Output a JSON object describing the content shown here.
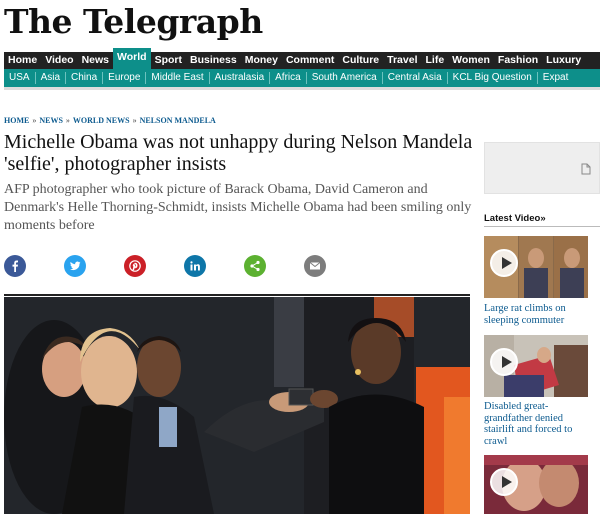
{
  "site": {
    "logo": "The Telegraph"
  },
  "nav_primary": [
    {
      "label": "Home"
    },
    {
      "label": "Video"
    },
    {
      "label": "News"
    },
    {
      "label": "World",
      "active": true
    },
    {
      "label": "Sport"
    },
    {
      "label": "Business"
    },
    {
      "label": "Money"
    },
    {
      "label": "Comment"
    },
    {
      "label": "Culture"
    },
    {
      "label": "Travel"
    },
    {
      "label": "Life"
    },
    {
      "label": "Women"
    },
    {
      "label": "Fashion"
    },
    {
      "label": "Luxury"
    }
  ],
  "nav_secondary": [
    {
      "label": "USA"
    },
    {
      "label": "Asia"
    },
    {
      "label": "China"
    },
    {
      "label": "Europe"
    },
    {
      "label": "Middle East"
    },
    {
      "label": "Australasia"
    },
    {
      "label": "Africa"
    },
    {
      "label": "South America"
    },
    {
      "label": "Central Asia"
    },
    {
      "label": "KCL Big Question"
    },
    {
      "label": "Expat"
    }
  ],
  "breadcrumb": [
    {
      "label": "HOME"
    },
    {
      "label": "NEWS"
    },
    {
      "label": "WORLD NEWS"
    },
    {
      "label": "NELSON MANDELA"
    }
  ],
  "article": {
    "headline": "Michelle Obama was not unhappy during Nelson Mandela 'selfie', photographer insists",
    "standfirst": "AFP photographer who took picture of Barack Obama, David Cameron and Denmark's Helle Thorning-Schmidt, insists Michelle Obama had been smiling only moments before"
  },
  "share_buttons": [
    {
      "name": "facebook-share-icon",
      "color": "#3b5998"
    },
    {
      "name": "twitter-share-icon",
      "color": "#2aa3ef"
    },
    {
      "name": "pinterest-share-icon",
      "color": "#cb2027"
    },
    {
      "name": "linkedin-share-icon",
      "color": "#0e76a8"
    },
    {
      "name": "share-icon",
      "color": "#5cb131"
    },
    {
      "name": "email-share-icon",
      "color": "#7d7d7d"
    }
  ],
  "sidebar": {
    "latest_video_label": "Latest Video»",
    "videos": [
      {
        "caption": "Large rat climbs on sleeping commuter"
      },
      {
        "caption": "Disabled great-grandfather denied stairlift and forced to crawl"
      },
      {
        "caption": ""
      }
    ]
  },
  "colors": {
    "accent": "#0d8f8a",
    "nav_dark": "#222222",
    "link": "#0d5b8f"
  }
}
